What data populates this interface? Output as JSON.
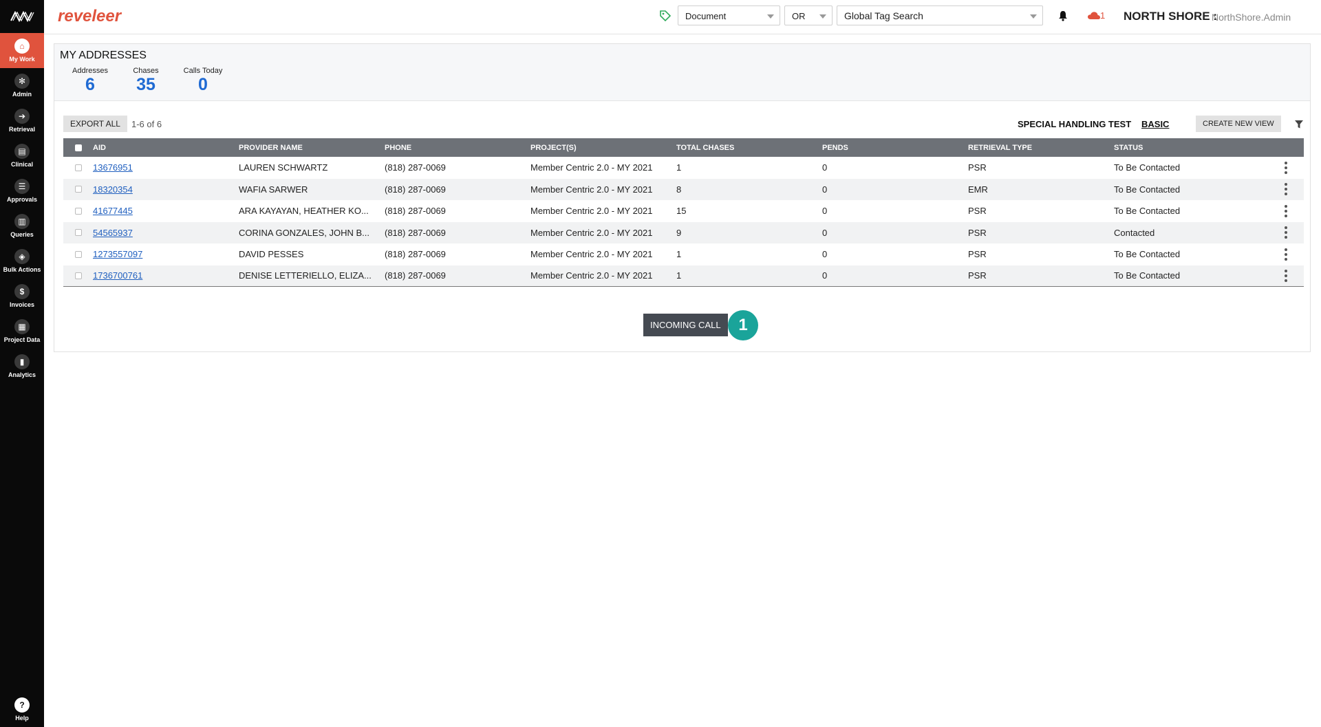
{
  "header": {
    "brand": "reveleer",
    "document_select": "Document",
    "operator_select": "OR",
    "tag_search": "Global Tag Search",
    "notification_count": "1",
    "org_name": "NORTH SHORE :",
    "user_name": "NorthShore.Admin"
  },
  "sidebar": {
    "items": [
      {
        "label": "My Work",
        "icon": "home-icon"
      },
      {
        "label": "Admin",
        "icon": "gear-icon"
      },
      {
        "label": "Retrieval",
        "icon": "arrow-right-icon"
      },
      {
        "label": "Clinical",
        "icon": "clipboard-icon"
      },
      {
        "label": "Approvals",
        "icon": "list-icon"
      },
      {
        "label": "Queries",
        "icon": "document-icon"
      },
      {
        "label": "Bulk Actions",
        "icon": "layers-icon"
      },
      {
        "label": "Invoices",
        "icon": "dollar-icon"
      },
      {
        "label": "Project Data",
        "icon": "grid-icon"
      },
      {
        "label": "Analytics",
        "icon": "chart-icon"
      }
    ],
    "help_label": "Help"
  },
  "summary": {
    "title": "MY ADDRESSES",
    "stats": [
      {
        "label": "Addresses",
        "value": "6"
      },
      {
        "label": "Chases",
        "value": "35"
      },
      {
        "label": "Calls Today",
        "value": "0"
      }
    ]
  },
  "toolbar": {
    "export_label": "EXPORT ALL",
    "pager": "1-6  of  6",
    "view_name": "SPECIAL HANDLING TEST",
    "view_basic": "BASIC",
    "create_view_label": "CREATE NEW VIEW"
  },
  "table": {
    "columns": [
      "AID",
      "PROVIDER NAME",
      "PHONE",
      "PROJECT(S)",
      "TOTAL CHASES",
      "PENDS",
      "RETRIEVAL TYPE",
      "STATUS"
    ],
    "rows": [
      {
        "aid": "13676951",
        "provider": "LAUREN SCHWARTZ",
        "phone": "(818) 287-0069",
        "project": "Member Centric 2.0 - MY 2021",
        "total": "1",
        "pends": "0",
        "retrieval": "PSR",
        "status": "To Be Contacted"
      },
      {
        "aid": "18320354",
        "provider": "WAFIA SARWER",
        "phone": "(818) 287-0069",
        "project": "Member Centric 2.0 - MY 2021",
        "total": "8",
        "pends": "0",
        "retrieval": "EMR",
        "status": "To Be Contacted"
      },
      {
        "aid": "41677445",
        "provider": "ARA KAYAYAN, HEATHER KO...",
        "phone": "(818) 287-0069",
        "project": "Member Centric 2.0 - MY 2021",
        "total": "15",
        "pends": "0",
        "retrieval": "PSR",
        "status": "To Be Contacted"
      },
      {
        "aid": "54565937",
        "provider": "CORINA GONZALES, JOHN B...",
        "phone": "(818) 287-0069",
        "project": "Member Centric 2.0 - MY 2021",
        "total": "9",
        "pends": "0",
        "retrieval": "PSR",
        "status": "Contacted"
      },
      {
        "aid": "1273557097",
        "provider": "DAVID PESSES",
        "phone": "(818) 287-0069",
        "project": "Member Centric 2.0 - MY 2021",
        "total": "1",
        "pends": "0",
        "retrieval": "PSR",
        "status": "To Be Contacted"
      },
      {
        "aid": "1736700761",
        "provider": "DENISE LETTERIELLO, ELIZA...",
        "phone": "(818) 287-0069",
        "project": "Member Centric 2.0 - MY 2021",
        "total": "1",
        "pends": "0",
        "retrieval": "PSR",
        "status": "To Be Contacted"
      }
    ]
  },
  "incoming_call": {
    "label": "INCOMING CALL",
    "badge": "1"
  },
  "colors": {
    "accent": "#e0533d",
    "link": "#1f5fbf",
    "stat_value": "#1f6ad3",
    "badge": "#1aa49a"
  }
}
